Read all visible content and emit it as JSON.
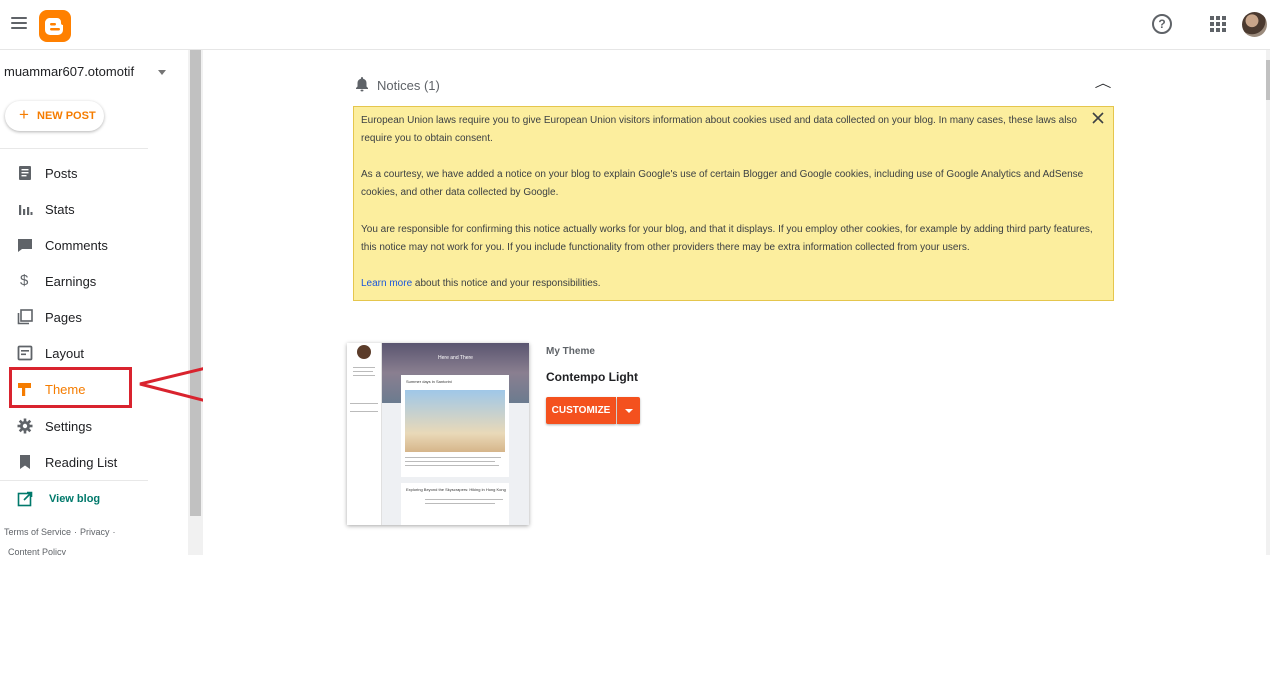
{
  "sidebar": {
    "blog_name": "muammar607.otomotif",
    "new_post_label": "NEW POST",
    "items": [
      {
        "label": "Posts",
        "icon": "posts-icon"
      },
      {
        "label": "Stats",
        "icon": "stats-icon"
      },
      {
        "label": "Comments",
        "icon": "comments-icon"
      },
      {
        "label": "Earnings",
        "icon": "earnings-icon"
      },
      {
        "label": "Pages",
        "icon": "pages-icon"
      },
      {
        "label": "Layout",
        "icon": "layout-icon"
      },
      {
        "label": "Theme",
        "icon": "theme-icon",
        "active": true
      },
      {
        "label": "Settings",
        "icon": "gear-icon"
      },
      {
        "label": "Reading List",
        "icon": "bookmark-icon"
      }
    ],
    "view_blog_label": "View blog",
    "footer": {
      "terms": "Terms of Service",
      "privacy": "Privacy",
      "content_policy": "Content Policy"
    }
  },
  "notices": {
    "title": "Notices (1)",
    "paragraphs": [
      "European Union laws require you to give European Union visitors information about cookies used and data collected on your blog. In many cases, these laws also require you to obtain consent.",
      "As a courtesy, we have added a notice on your blog to explain Google's use of certain Blogger and Google cookies, including use of Google Analytics and AdSense cookies, and other data collected by Google.",
      "You are responsible for confirming this notice actually works for your blog, and that it displays. If you employ other cookies, for example by adding third party features, this notice may not work for you. If you include functionality from other providers there may be extra information collected from your users."
    ],
    "learn_more": "Learn more",
    "learn_more_suffix": " about this notice and your responsibilities."
  },
  "theme": {
    "section_label": "My Theme",
    "name": "Contempo Light",
    "customize_label": "CUSTOMIZE",
    "preview": {
      "banner_title": "Here and There",
      "post1_title": "Summer days in Santorini",
      "post2_title": "Exploring Beyond the Skyscrapers: Hiking in Hong Kong"
    }
  },
  "colors": {
    "accent": "#f57c00",
    "customize": "#f4511e",
    "notice_bg": "#fcee9e",
    "annotation": "#d9232e"
  }
}
